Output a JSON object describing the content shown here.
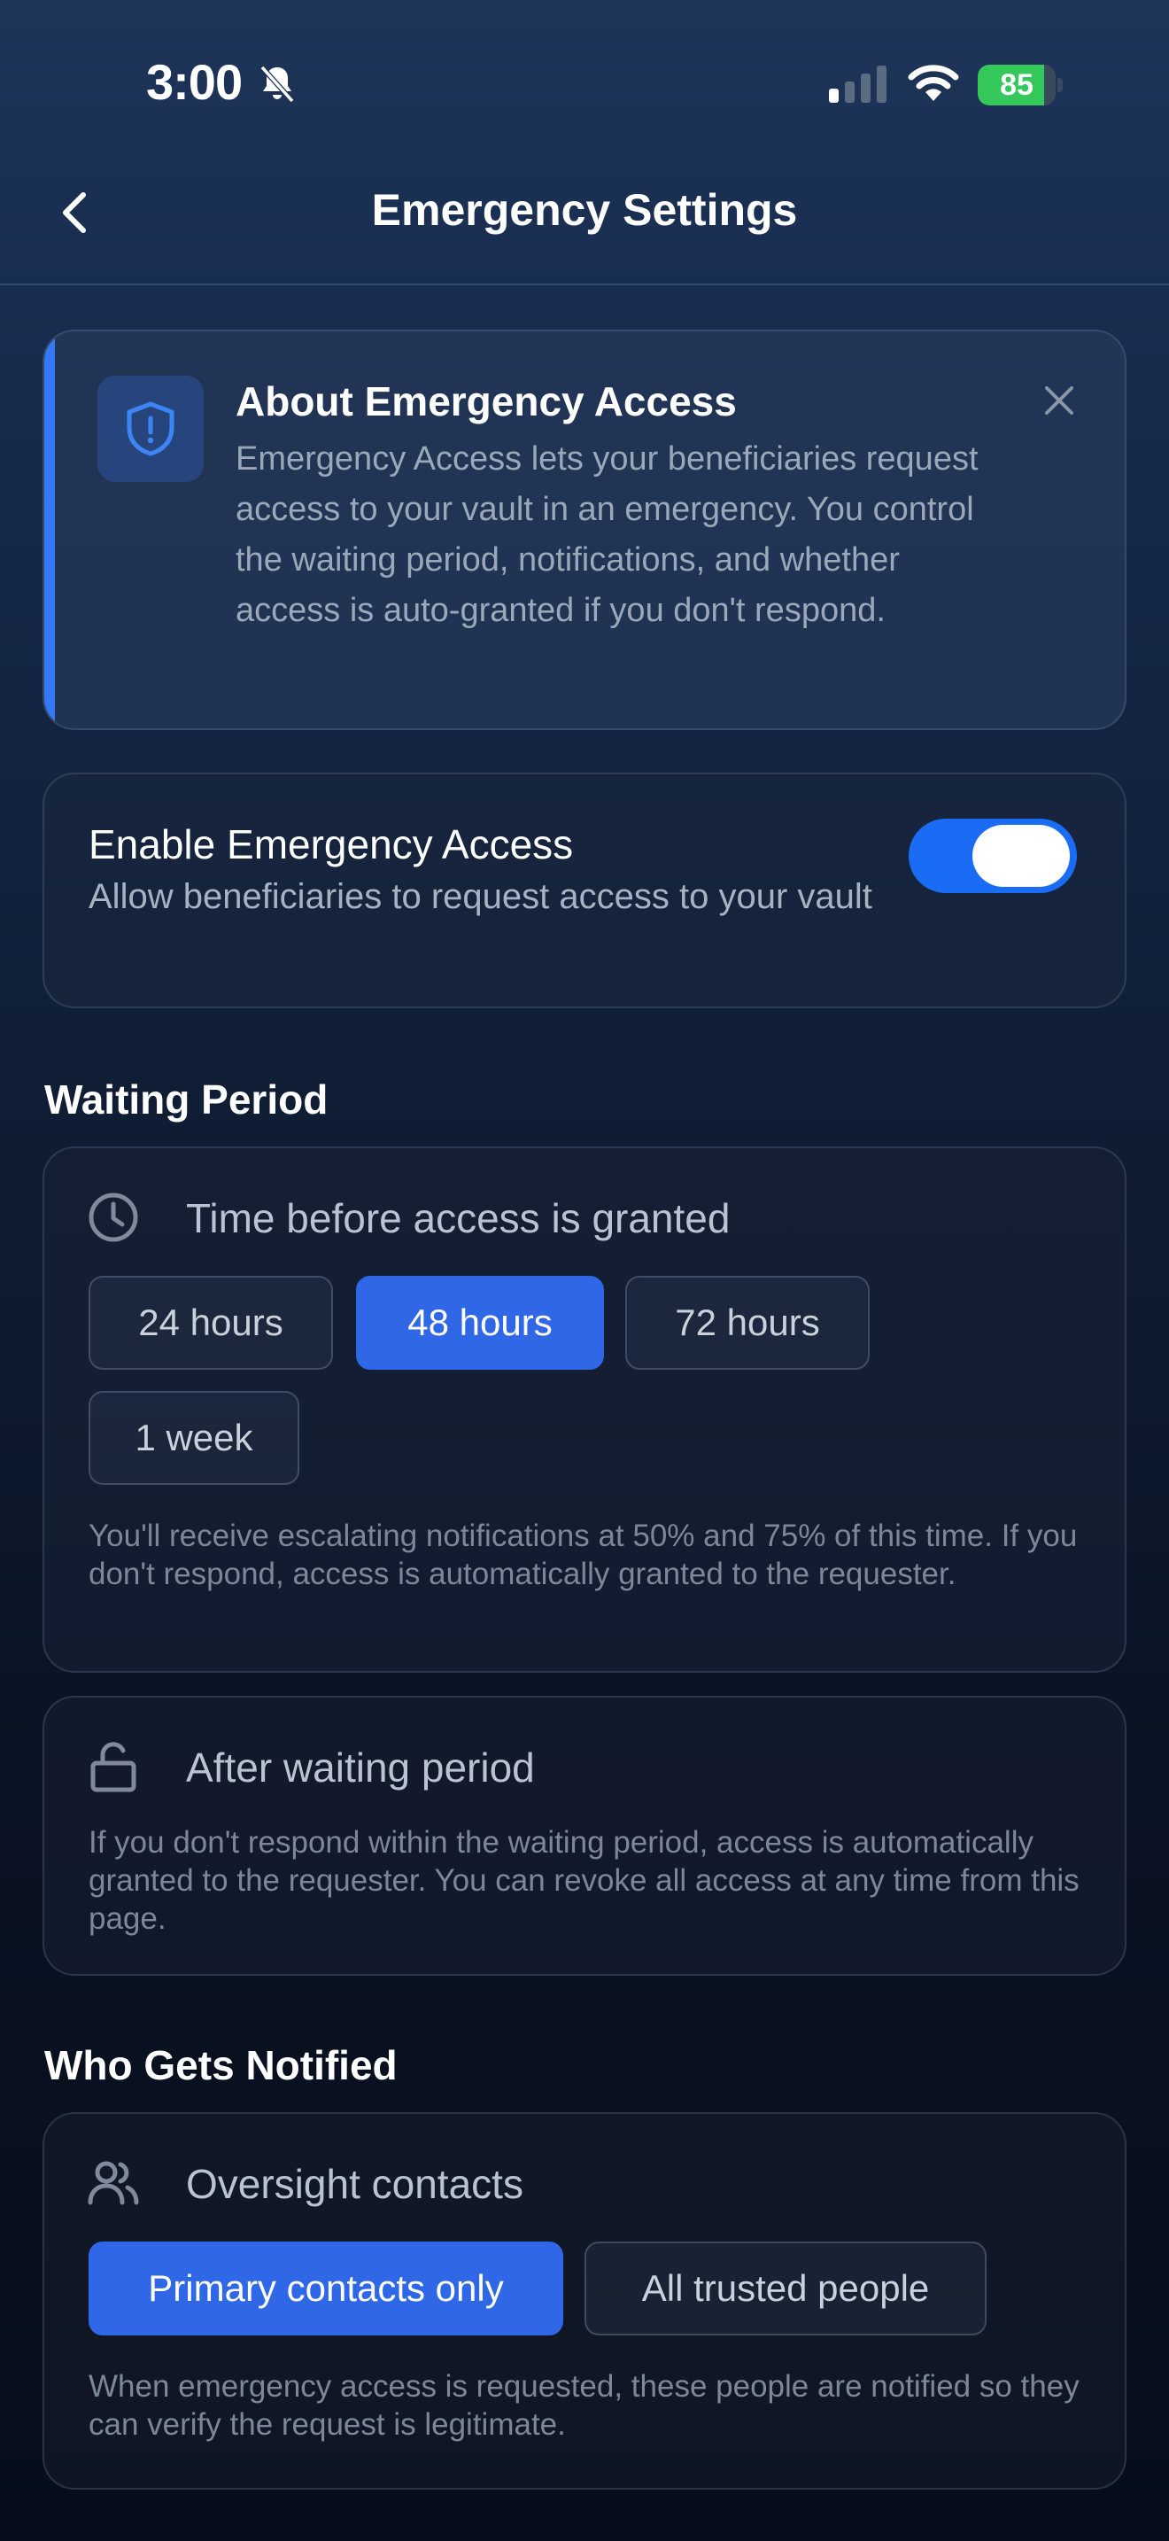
{
  "status_bar": {
    "time": "3:00",
    "battery_level": "85",
    "battery_fraction": 0.85,
    "accent_color": "#34c759"
  },
  "nav": {
    "title": "Emergency Settings",
    "back_icon": "chevron-left-icon"
  },
  "info": {
    "icon": "shield-alert-icon",
    "title": "About Emergency Access",
    "body": "Emergency Access lets your beneficiaries request access to your vault in an emergency. You control the waiting period, notifications, and whether access is auto-granted if you don't respond.",
    "close_icon": "close-icon",
    "accent_color": "#3478f6"
  },
  "toggle": {
    "title": "Enable Emergency Access",
    "description": "Allow beneficiaries to request access to your vault",
    "enabled": true,
    "color": "#1a6cf5"
  },
  "waiting_period": {
    "section_title": "Waiting Period",
    "label": "Time before access is granted",
    "icon": "clock-icon",
    "options": [
      "24 hours",
      "48 hours",
      "72 hours",
      "1 week"
    ],
    "selected": "48 hours",
    "note": "You'll receive escalating notifications at 50% and 75% of this time. If you don't respond, access is automatically granted to the requester."
  },
  "after_period": {
    "label": "After waiting period",
    "icon": "unlock-icon",
    "note": "If you don't respond within the waiting period, access is automatically granted to the requester. You can revoke all access at any time from this page."
  },
  "notify": {
    "section_title": "Who Gets Notified",
    "label": "Oversight contacts",
    "icon": "users-icon",
    "options": [
      "Primary contacts only",
      "All trusted people"
    ],
    "selected": "Primary contacts only",
    "note": "When emergency access is requested, these people are notified so they can verify the request is legitimate."
  }
}
